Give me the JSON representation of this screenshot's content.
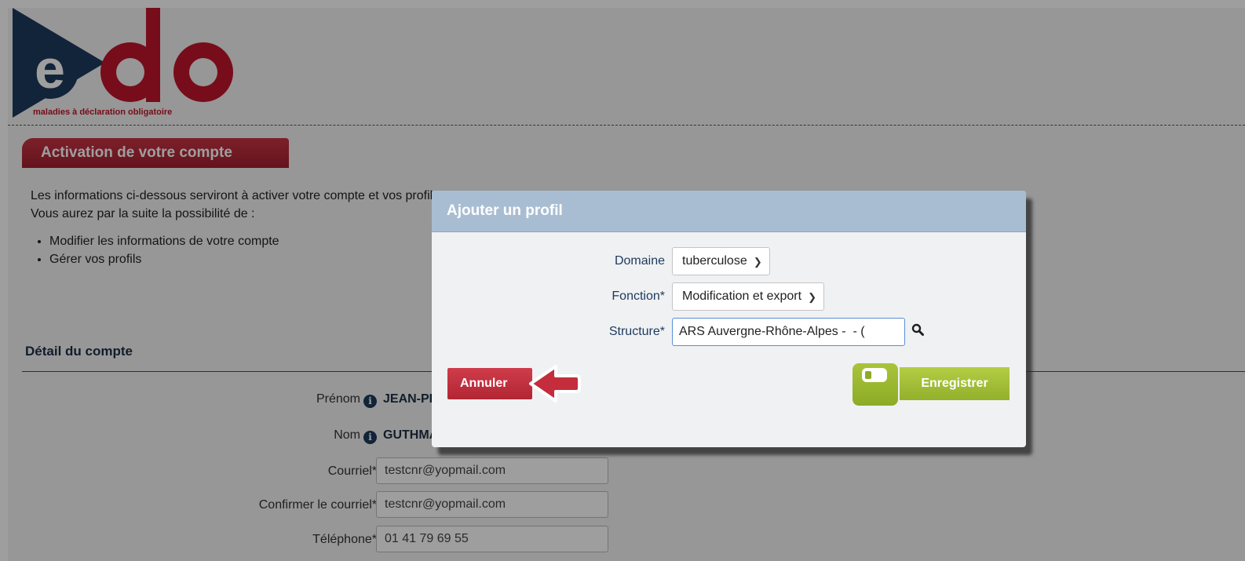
{
  "logo": {
    "letters": "edo",
    "tagline": "maladies à déclaration obligatoire",
    "colors": {
      "navy": "#1d3a5c",
      "red": "#c0162c"
    }
  },
  "page": {
    "title": "Activation de votre compte",
    "intro_line1": "Les informations ci-dessous serviront à activer votre compte et vos profils.",
    "intro_line2": "Vous aurez par la suite la possibilité de :",
    "bullets": [
      "Modifier les informations de votre compte",
      "Gérer vos profils"
    ],
    "section_title": "Détail du compte"
  },
  "account": {
    "prenom_label": "Prénom",
    "prenom_value": "JEAN-PIERRE",
    "nom_label": "Nom",
    "nom_value": "GUTHMANN",
    "courriel_label": "Courriel*",
    "courriel_value": "testcnr@yopmail.com",
    "confirm_label": "Confirmer le courriel*",
    "confirm_value": "testcnr@yopmail.com",
    "telephone_label": "Téléphone*",
    "telephone_value": "01 41 79 69 55"
  },
  "dialog": {
    "title": "Ajouter un profil",
    "domaine_label": "Domaine",
    "domaine_value": "tuberculose",
    "fonction_label": "Fonction*",
    "fonction_value": "Modification et export",
    "structure_label": "Structure*",
    "structure_value": "ARS Auvergne-Rhône-Alpes -  - (",
    "cancel_label": "Annuler",
    "save_label": "Enregistrer",
    "icons": {
      "search": "search-icon",
      "back": "back-arrow-icon",
      "save": "save-icon"
    },
    "colors": {
      "cancel": "#c0303f",
      "save": "#9fbd33",
      "header": "#a8bdd2"
    }
  }
}
